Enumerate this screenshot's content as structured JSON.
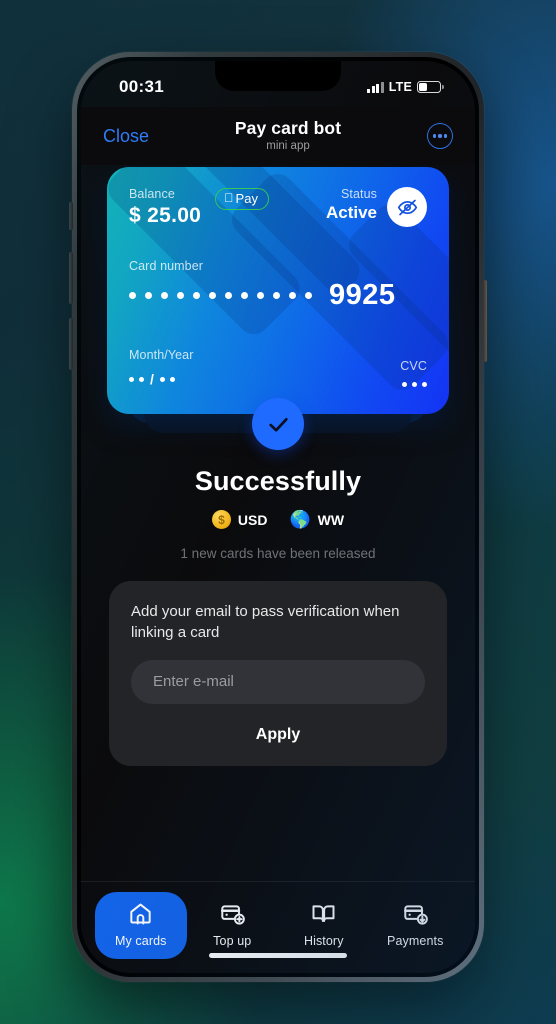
{
  "status_bar": {
    "time": "00:31",
    "network": "LTE",
    "signal_icon": "signal-bars-icon",
    "battery_icon": "battery-icon"
  },
  "header": {
    "close_label": "Close",
    "title": "Pay card bot",
    "subtitle": "mini app",
    "more_icon": "more-options-icon"
  },
  "card": {
    "balance_label": "Balance",
    "balance_value": "$ 25.00",
    "apple_pay_label": "Pay",
    "apple_pay_icon": "apple-logo-icon",
    "status_label": "Status",
    "status_value": "Active",
    "hide_icon": "eye-off-icon",
    "number_label": "Card number",
    "masked_groups": [
      "••••",
      "••••",
      "••••"
    ],
    "last4": "9925",
    "expiry_label": "Month/Year",
    "expiry_value": "••/••",
    "cvc_label": "CVC",
    "cvc_value": "•••",
    "gradient_from": "#13b3b8",
    "gradient_to": "#1433f5"
  },
  "success": {
    "check_icon": "check-circle-icon",
    "title": "Successfully",
    "badges": [
      {
        "icon": "dollar-coin-icon",
        "label": "USD"
      },
      {
        "icon": "globe-icon",
        "label": "WW"
      }
    ],
    "released_text": "1 new cards have been released",
    "accent_color": "#1f6bff"
  },
  "form": {
    "description": "Add your email to pass verification when linking a card",
    "email_placeholder": "Enter e-mail",
    "email_value": "",
    "apply_label": "Apply"
  },
  "tabbar": {
    "items": [
      {
        "label": "My cards",
        "icon": "home-icon",
        "active": true
      },
      {
        "label": "Top up",
        "icon": "card-plus-icon",
        "active": false
      },
      {
        "label": "History",
        "icon": "book-icon",
        "active": false
      },
      {
        "label": "Payments",
        "icon": "card-download-icon",
        "active": false
      }
    ],
    "active_color": "#1465ec"
  }
}
